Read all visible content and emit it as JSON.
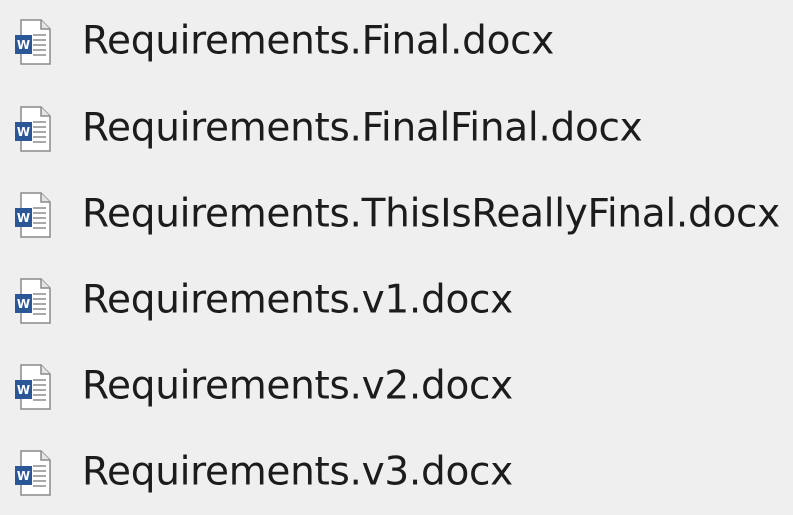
{
  "files": [
    {
      "name": "Requirements.Final.docx",
      "icon": "word-document-icon"
    },
    {
      "name": "Requirements.FinalFinal.docx",
      "icon": "word-document-icon"
    },
    {
      "name": "Requirements.ThisIsReallyFinal.docx",
      "icon": "word-document-icon"
    },
    {
      "name": "Requirements.v1.docx",
      "icon": "word-document-icon"
    },
    {
      "name": "Requirements.v2.docx",
      "icon": "word-document-icon"
    },
    {
      "name": "Requirements.v3.docx",
      "icon": "word-document-icon"
    }
  ],
  "colors": {
    "background": "#efefef",
    "text": "#1c1c1c",
    "word_blue": "#2b5797"
  }
}
